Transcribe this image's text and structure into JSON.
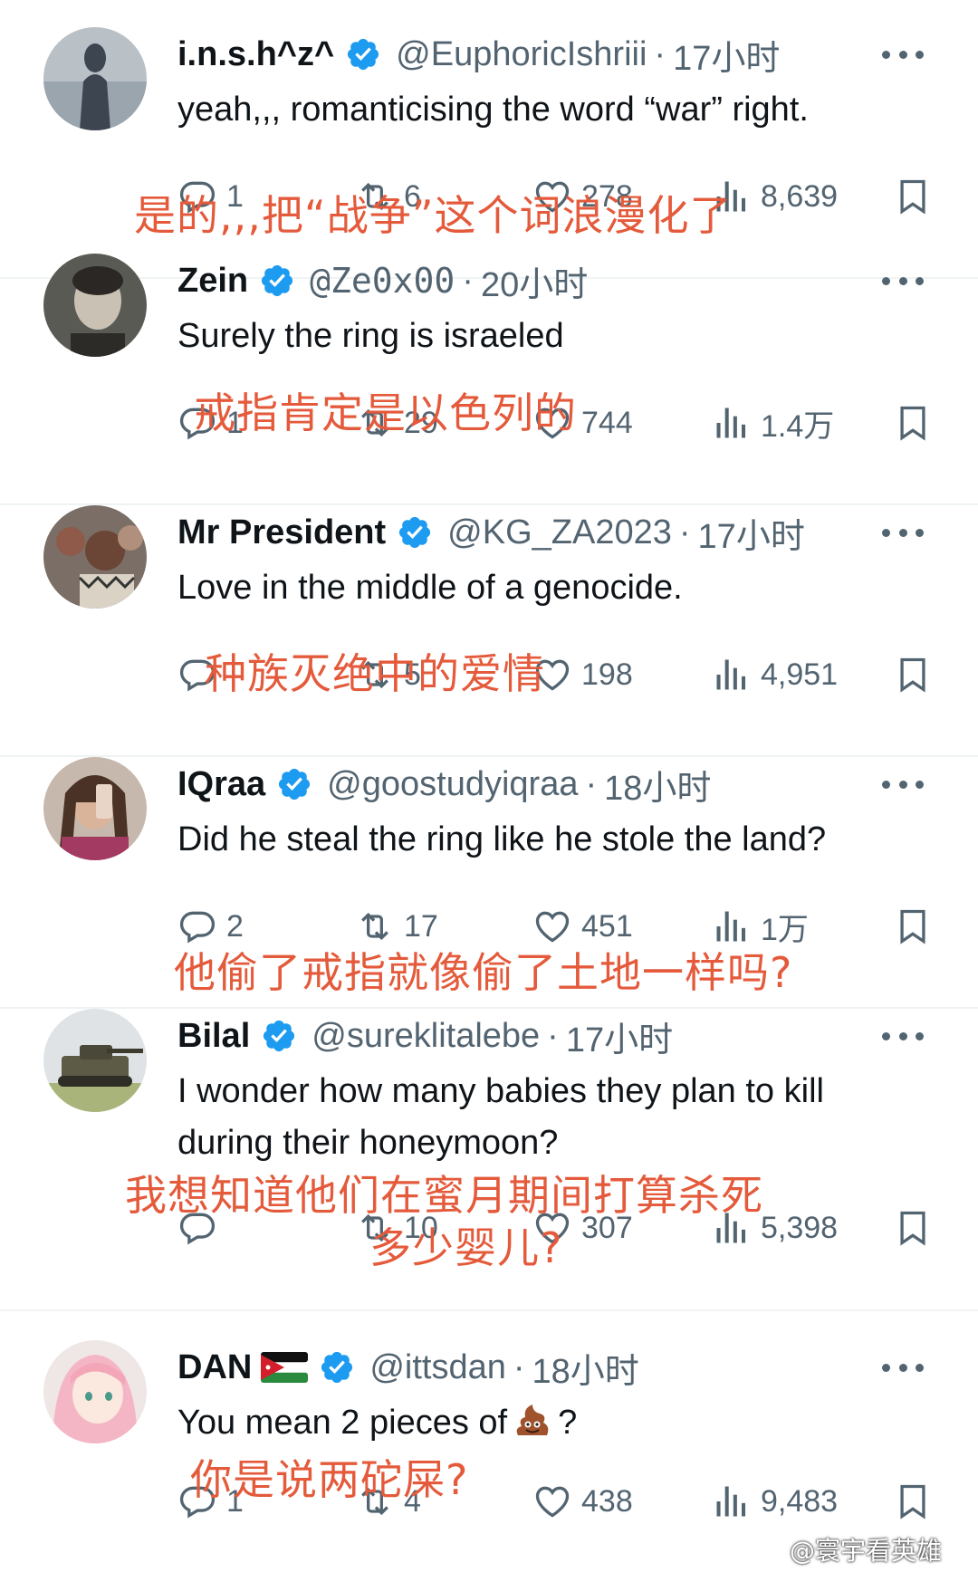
{
  "replies": [
    {
      "name": "i.n.s.h^z^",
      "handle": "@EuphoricIshriii",
      "time": "17小时",
      "text": "yeah,,, romanticising the word “war” right.",
      "replies": "1",
      "retweets": "6",
      "likes": "278",
      "views": "8,639",
      "translation": "是的,,,把“战争”这个词浪漫化了",
      "avatar": "silhouette-avatar"
    },
    {
      "name": "Zein",
      "handle": "@Ze0x00",
      "time": "20小时",
      "text": "Surely the ring is israeled",
      "replies": "1",
      "retweets": "29",
      "likes": "744",
      "views": "1.4万",
      "translation": "戒指肯定是以色列的",
      "avatar": "portrait-avatar"
    },
    {
      "name": "Mr President",
      "handle": "@KG_ZA2023",
      "time": "17小时",
      "text": "Love in the middle of a genocide.",
      "replies": "",
      "retweets": "5",
      "likes": "198",
      "views": "4,951",
      "translation": "种族灭绝中的爱情",
      "avatar": "crowd-avatar"
    },
    {
      "name": "IQraa",
      "handle": "@goostudyiqraa",
      "time": "18小时",
      "text": "Did he steal the ring like he stole the land?",
      "replies": "2",
      "retweets": "17",
      "likes": "451",
      "views": "1万",
      "translation": "他偷了戒指就像偷了土地一样吗?",
      "avatar": "selfie-avatar"
    },
    {
      "name": "Bilal",
      "handle": "@sureklitalebe",
      "time": "17小时",
      "text": "I wonder how many babies they plan to kill during their honeymoon?",
      "replies": "",
      "retweets": "10",
      "likes": "307",
      "views": "5,398",
      "translation_line1": "我想知道他们在蜜月期间打算杀死",
      "translation_line2": "多少婴儿?",
      "avatar": "tank-avatar"
    },
    {
      "name": "DAN",
      "handle": "@ittsdan",
      "time": "18小时",
      "text_before": "You mean 2 pieces of",
      "text_after": "?",
      "replies": "1",
      "retweets": "4",
      "likes": "438",
      "views": "9,483",
      "translation": "你是说两砣屎?",
      "avatar": "anime-avatar",
      "flag": "jordan-flag-icon"
    }
  ],
  "watermark": "@寰宇看英雄",
  "colors": {
    "verified": "#1d9bf0",
    "muted": "#536471",
    "translation": "#e45a3b"
  }
}
